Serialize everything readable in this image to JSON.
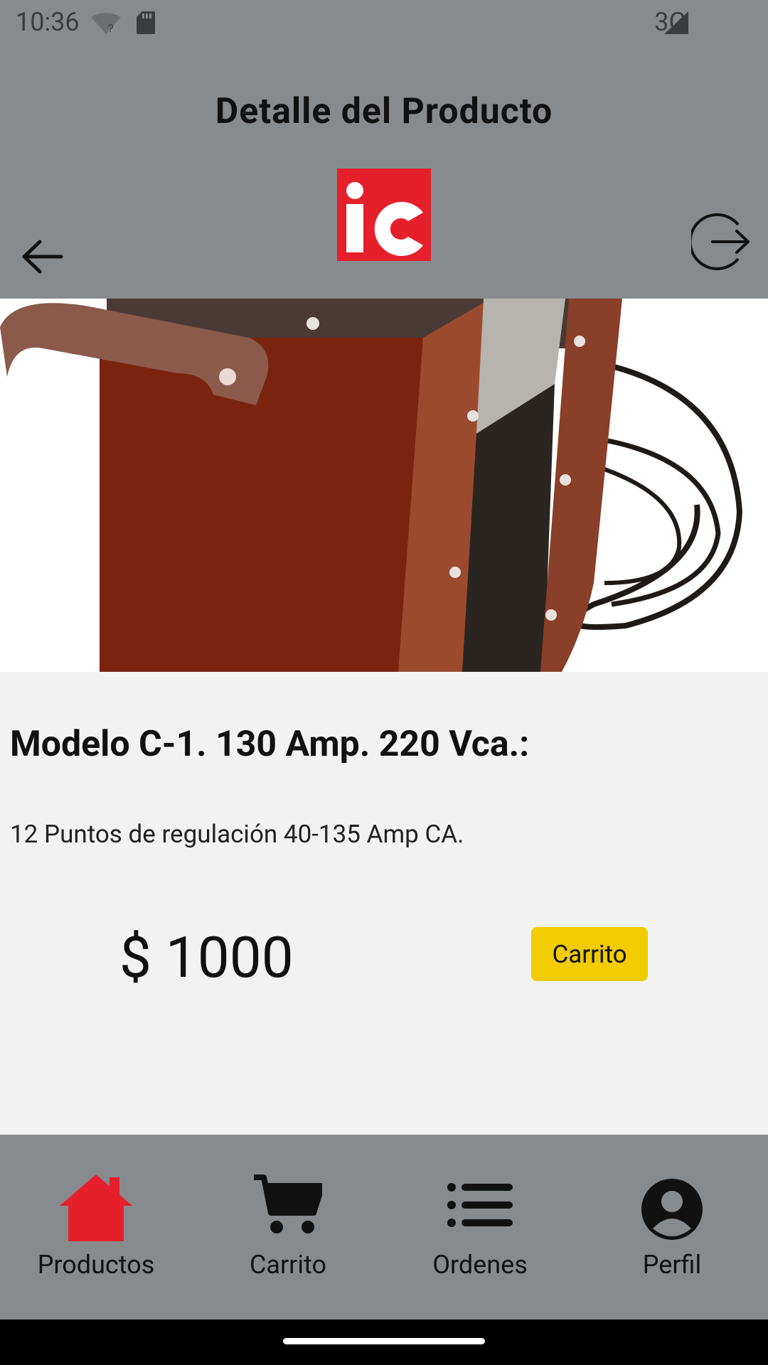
{
  "status_bar": {
    "time": "10:36",
    "network": "3G"
  },
  "header": {
    "title": "Detalle del Producto"
  },
  "product": {
    "name": "Modelo C-1. 130 Amp. 220 Vca.:",
    "description": "12 Puntos de regulación 40-135 Amp CA.",
    "price": "$ 1000",
    "cart_button_label": "Carrito"
  },
  "bottom_nav": {
    "items": [
      {
        "label": "Productos",
        "icon": "home-icon",
        "active": true
      },
      {
        "label": "Carrito",
        "icon": "cart-icon",
        "active": false
      },
      {
        "label": "Ordenes",
        "icon": "list-icon",
        "active": false
      },
      {
        "label": "Perfil",
        "icon": "account-icon",
        "active": false
      }
    ]
  },
  "colors": {
    "header_bg": "#878b8e",
    "brand_red": "#e5202b",
    "cart_button": "#f0cc00",
    "active_nav": "#e5202b",
    "content_bg": "#f2f2f2"
  }
}
